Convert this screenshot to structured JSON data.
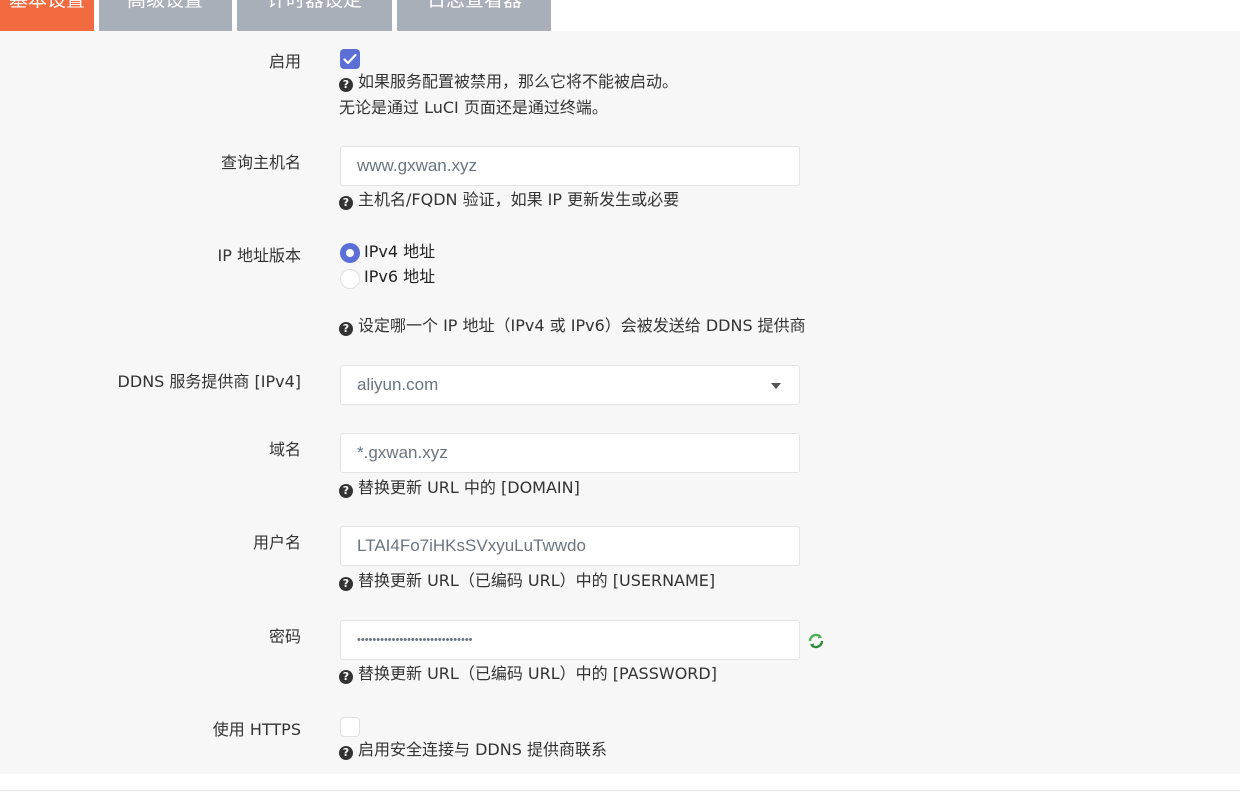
{
  "tabs": [
    {
      "label": "基本设置",
      "active": true
    },
    {
      "label": "高级设置",
      "active": false
    },
    {
      "label": "计时器设定",
      "active": false
    },
    {
      "label": "日志查看器",
      "active": false
    }
  ],
  "fields": {
    "enable": {
      "label": "启用",
      "checked": true,
      "help_line1": "如果服务配置被禁用，那么它将不能被启动。",
      "help_line2": "无论是通过 LuCI 页面还是通过终端。"
    },
    "lookup_host": {
      "label": "查询主机名",
      "value": "www.gxwan.xyz",
      "help": "主机名/FQDN 验证，如果 IP 更新发生或必要"
    },
    "ip_version": {
      "label": "IP 地址版本",
      "options": [
        "IPv4 地址",
        "IPv6 地址"
      ],
      "selected": "IPv4 地址",
      "help": "设定哪一个 IP 地址（IPv4 或 IPv6）会被发送给 DDNS 提供商"
    },
    "provider": {
      "label": "DDNS 服务提供商 [IPv4]",
      "value": "aliyun.com"
    },
    "domain": {
      "label": "域名",
      "value": "*.gxwan.xyz",
      "help": "替换更新 URL 中的 [DOMAIN]"
    },
    "username": {
      "label": "用户名",
      "value": "LTAI4Fo7iHKsSVxyuLuTwwdo",
      "help": "替换更新 URL（已编码 URL）中的 [USERNAME]"
    },
    "password": {
      "label": "密码",
      "value": "••••••••••••••••••••••••••••••",
      "help": "替换更新 URL（已编码 URL）中的 [PASSWORD]",
      "reveal_icon": "refresh-icon"
    },
    "use_https": {
      "label": "使用 HTTPS",
      "checked": false,
      "help": "启用安全连接与 DDNS 提供商联系"
    }
  },
  "colors": {
    "active_tab": "#f26a3f",
    "inactive_tab": "#a8afb8",
    "accent": "#5b6fd6",
    "panel_bg": "#f7f7f7"
  }
}
